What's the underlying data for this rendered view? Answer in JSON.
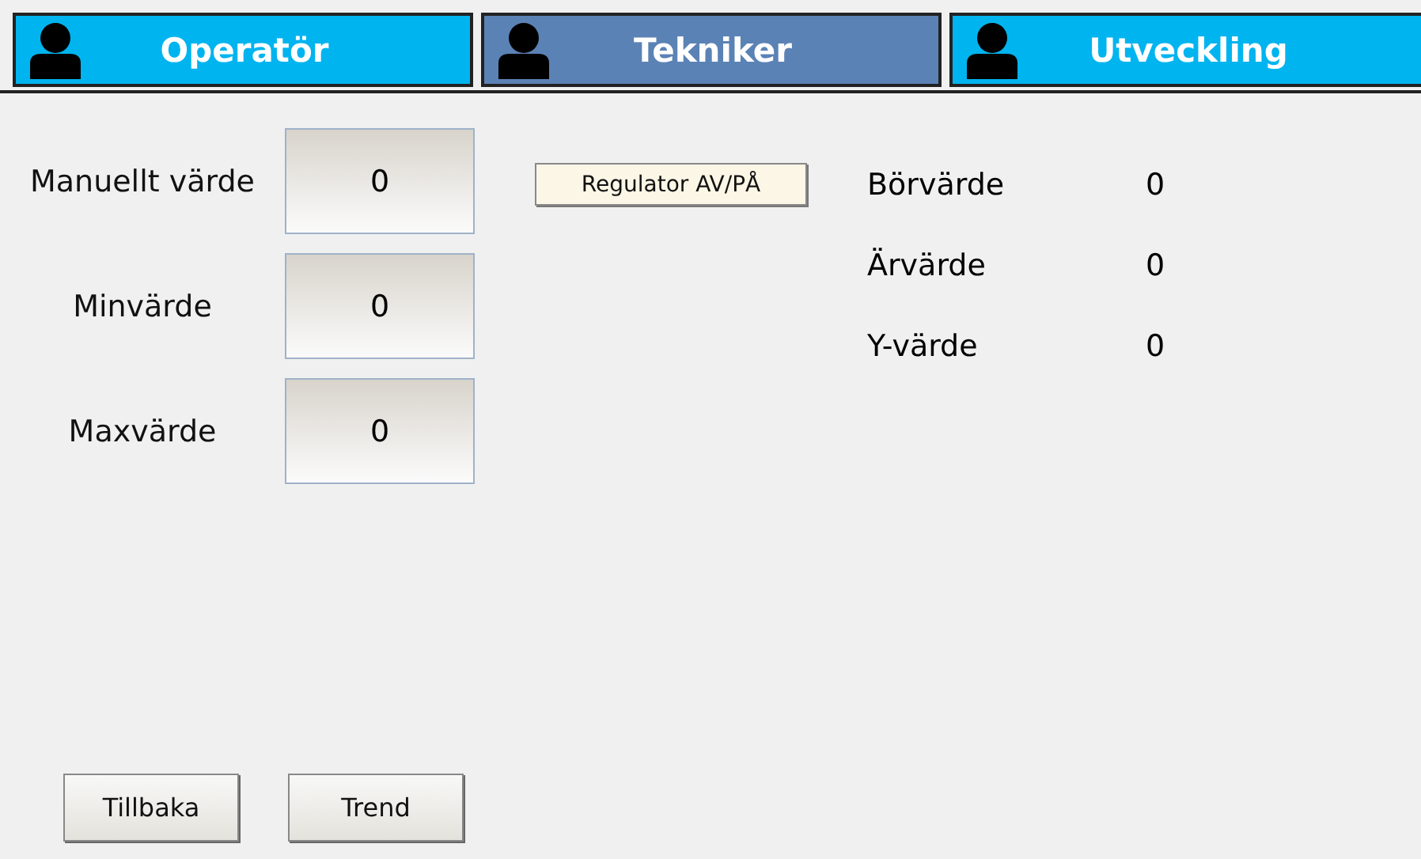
{
  "tabs": [
    {
      "label": "Operatör",
      "selected": false
    },
    {
      "label": "Tekniker",
      "selected": true
    },
    {
      "label": "Utveckling",
      "selected": false
    }
  ],
  "inputs": [
    {
      "label": "Manuellt värde",
      "value": "0"
    },
    {
      "label": "Minvärde",
      "value": "0"
    },
    {
      "label": "Maxvärde",
      "value": "0"
    }
  ],
  "toggle_button": "Regulator AV/PÅ",
  "readouts": [
    {
      "label": "Börvärde",
      "value": "0"
    },
    {
      "label": "Ärvärde",
      "value": "0"
    },
    {
      "label": "Y-värde",
      "value": "0"
    }
  ],
  "buttons": [
    "Tillbaka",
    "Trend"
  ]
}
